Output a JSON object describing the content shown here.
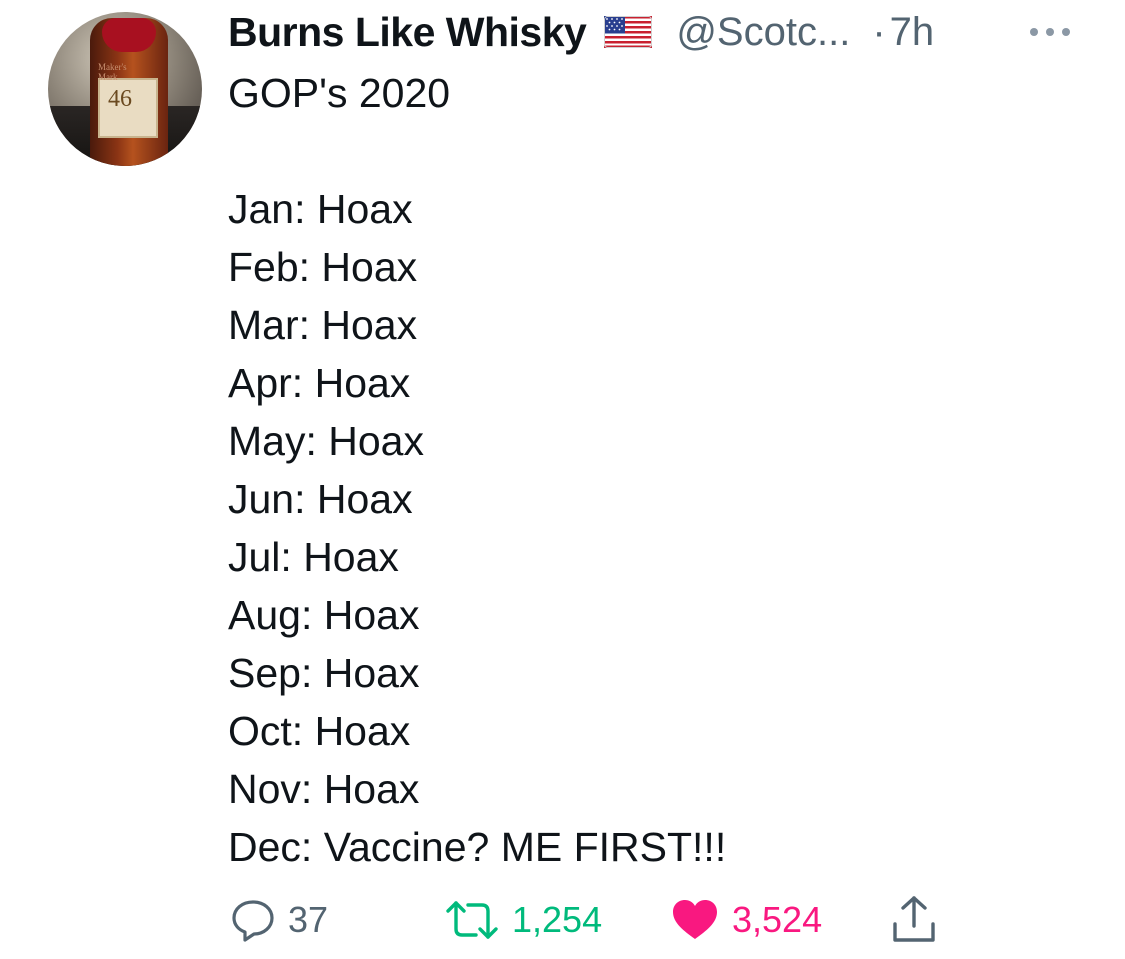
{
  "tweet": {
    "author": {
      "display_name": "Burns Like Whisky",
      "handle": "@Scotc...",
      "flag_icon": "us-flag-icon",
      "avatar": {
        "label_number": "46",
        "label_brand": "Maker's Mark"
      }
    },
    "separator": "·",
    "timestamp": "7h",
    "more_icon": "more-horizontal-icon",
    "text_title": "GOP's 2020",
    "text_lines": [
      "Jan: Hoax",
      "Feb: Hoax",
      "Mar: Hoax",
      "Apr: Hoax",
      "May: Hoax",
      "Jun: Hoax",
      "Jul: Hoax",
      "Aug: Hoax",
      "Sep: Hoax",
      "Oct: Hoax",
      "Nov: Hoax",
      "Dec: Vaccine? ME FIRST!!!"
    ],
    "actions": {
      "reply": {
        "icon": "reply-icon",
        "count": "37",
        "color": "#536471"
      },
      "retweet": {
        "icon": "retweet-icon",
        "count": "1,254",
        "color": "#00ba7c"
      },
      "like": {
        "icon": "heart-icon",
        "count": "3,524",
        "color": "#f91880",
        "liked": true
      },
      "share": {
        "icon": "share-icon",
        "color": "#536471"
      }
    }
  }
}
